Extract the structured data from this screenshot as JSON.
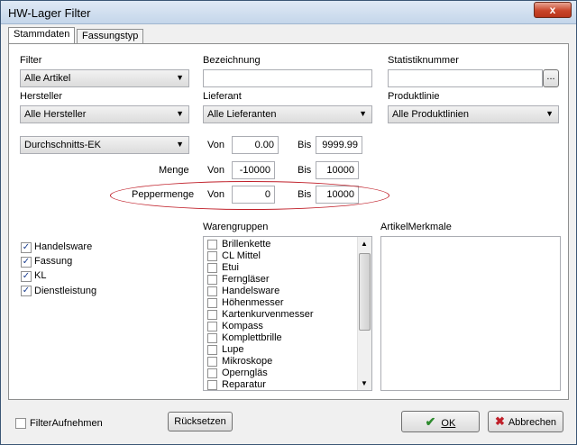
{
  "window": {
    "title": "HW-Lager Filter",
    "close": "x"
  },
  "tabs": [
    {
      "label": "Stammdaten"
    },
    {
      "label": "Fassungstyp"
    }
  ],
  "filter": {
    "label": "Filter",
    "value": "Alle Artikel"
  },
  "bezeichnung": {
    "label": "Bezeichnung",
    "value": ""
  },
  "statistik": {
    "label": "Statistiknummer",
    "value": "",
    "browse": "..."
  },
  "hersteller": {
    "label": "Hersteller",
    "value": "Alle Hersteller"
  },
  "lieferant": {
    "label": "Lieferant",
    "value": "Alle Lieferanten"
  },
  "produktlinie": {
    "label": "Produktlinie",
    "value": "Alle Produktlinien"
  },
  "price": {
    "select": "Durchschnitts-EK",
    "von_label": "Von",
    "von": "0.00",
    "bis_label": "Bis",
    "bis": "9999.99"
  },
  "menge": {
    "label": "Menge",
    "von_label": "Von",
    "von": "-10000",
    "bis_label": "Bis",
    "bis": "10000"
  },
  "peppermenge": {
    "label": "Peppermenge",
    "von_label": "Von",
    "von": "0",
    "bis_label": "Bis",
    "bis": "10000"
  },
  "types": [
    {
      "label": "Handelsware",
      "checked": true
    },
    {
      "label": "Fassung",
      "checked": true
    },
    {
      "label": "KL",
      "checked": true
    },
    {
      "label": "Dienstleistung",
      "checked": true
    }
  ],
  "warengruppen": {
    "label": "Warengruppen",
    "items": [
      "Brillenkette",
      "CL Mittel",
      "Etui",
      "Ferngläser",
      "Handelsware",
      "Höhenmesser",
      "Kartenkurvenmesser",
      "Kompass",
      "Komplettbrille",
      "Lupe",
      "Mikroskope",
      "Operngläs",
      "Reparatur"
    ]
  },
  "artikelmerkmale": {
    "label": "ArtikelMerkmale"
  },
  "bottom": {
    "filter_aufnehmen": "FilterAufnehmen",
    "ruecksetzen": "Rücksetzen",
    "ok": "OK",
    "abbrechen": "Abbrechen"
  }
}
